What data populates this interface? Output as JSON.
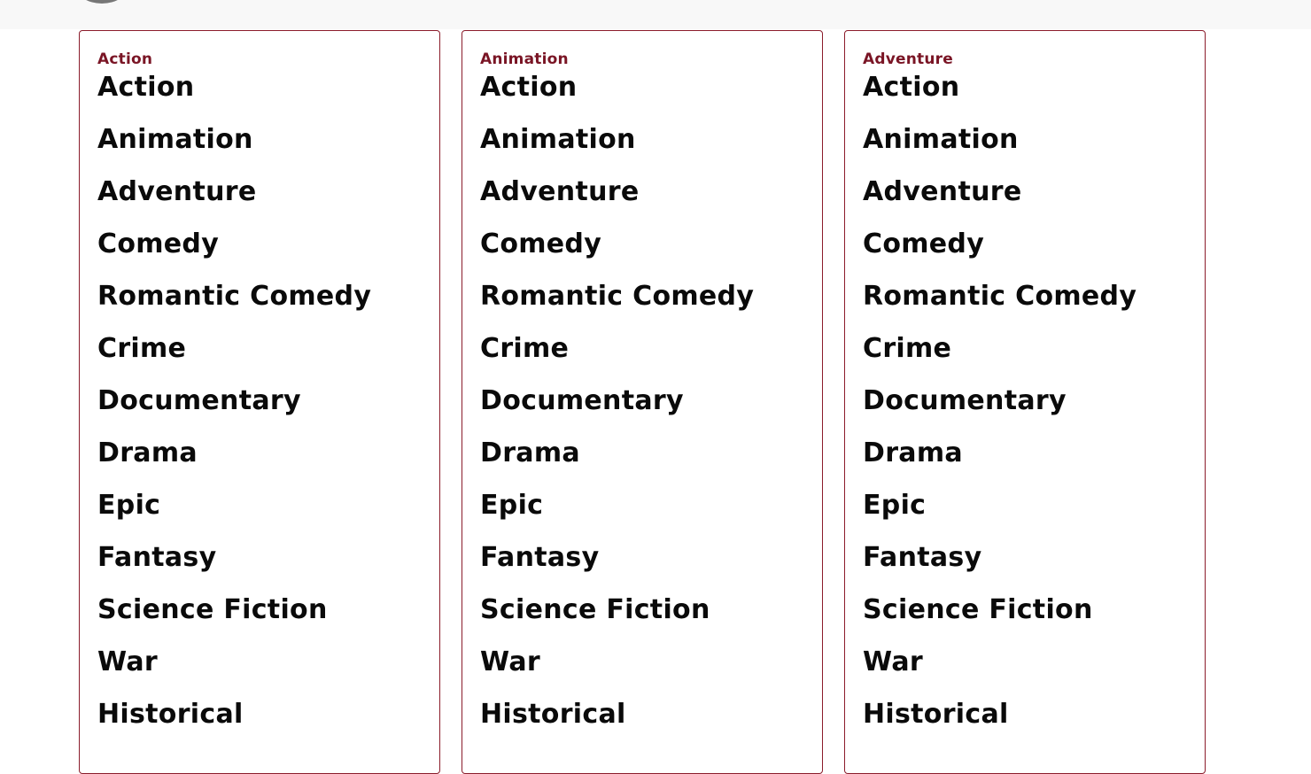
{
  "columns": [
    {
      "title": "Action",
      "genres": [
        "Action",
        "Animation",
        "Adventure",
        "Comedy",
        "Romantic Comedy",
        "Crime",
        "Documentary",
        "Drama",
        "Epic",
        "Fantasy",
        "Science Fiction",
        "War",
        "Historical"
      ]
    },
    {
      "title": "Animation",
      "genres": [
        "Action",
        "Animation",
        "Adventure",
        "Comedy",
        "Romantic Comedy",
        "Crime",
        "Documentary",
        "Drama",
        "Epic",
        "Fantasy",
        "Science Fiction",
        "War",
        "Historical"
      ]
    },
    {
      "title": "Adventure",
      "genres": [
        "Action",
        "Animation",
        "Adventure",
        "Comedy",
        "Romantic Comedy",
        "Crime",
        "Documentary",
        "Drama",
        "Epic",
        "Fantasy",
        "Science Fiction",
        "War",
        "Historical"
      ]
    }
  ],
  "colors": {
    "accent": "#7a1525",
    "border": "#8b1c2b",
    "text": "#0a0a0a",
    "topbar": "#f8f8f8"
  },
  "icons": {
    "logo": "logo-icon"
  }
}
